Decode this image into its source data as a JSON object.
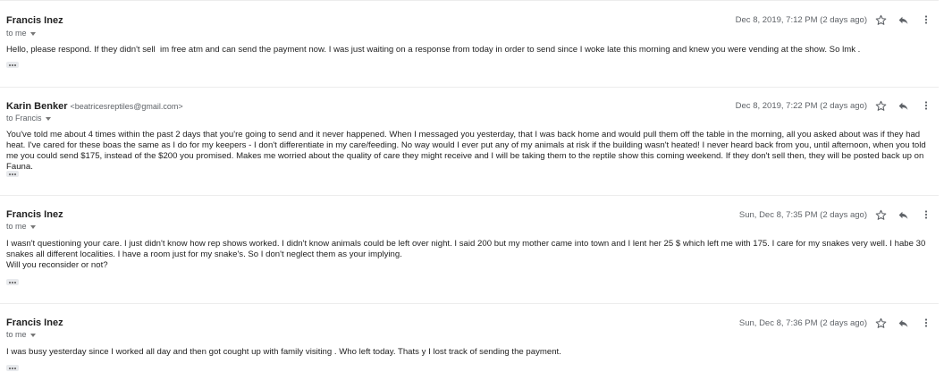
{
  "messages": [
    {
      "sender": "Francis Inez",
      "email": "",
      "to": "to me",
      "date": "Dec 8, 2019, 7:12 PM (2 days ago)",
      "body": "Hello, please respond. If they didn't sell  im free atm and can send the payment now. I was just waiting on a response from today in order to send since I woke late this morning and knew you were vending at the show. So lmk ."
    },
    {
      "sender": "Karin Benker",
      "email": "<beatricesreptiles@gmail.com>",
      "to": "to Francis",
      "date": "Dec 8, 2019, 7:22 PM (2 days ago)",
      "body": "You've told me about 4 times within the past 2 days that you're going to send and it never happened. When I messaged you yesterday, that I was back home and would pull them off the table in the morning, all you asked about was if they had heat. I've cared for these boas the same as I do for my keepers - I don't differentiate in my care/feeding. No way would I ever put any of my animals at risk if the building wasn't heated! I never heard back from you, until afternoon, when you told me you could send $175, instead of the $200 you promised. Makes me worried about the quality of care they might receive and I will be taking them to the reptile show this coming weekend. If they don't sell then, they will be posted back up on Fauna."
    },
    {
      "sender": "Francis Inez",
      "email": "",
      "to": "to me",
      "date": "Sun, Dec 8, 7:35 PM (2 days ago)",
      "body": "I wasn't questioning your care. I just didn't know how rep shows worked. I didn't know animals could be left over night. I said 200 but my mother came into town and I lent her 25 $ which left me with 175. I care for my snakes very well. I habe 30 snakes all different localities. I have a room just for my snake's. So I don't neglect them as your implying.\nWill you reconsider or not?"
    },
    {
      "sender": "Francis Inez",
      "email": "",
      "to": "to me",
      "date": "Sun, Dec 8, 7:36 PM (2 days ago)",
      "body": "I was busy yesterday since I worked all day and then got cought up with family visiting . Who left today. Thats y I lost track of sending the payment."
    }
  ],
  "icons": {
    "star": "star-icon",
    "reply": "reply-icon",
    "more": "more-vert-icon",
    "expand": "ellipsis-icon"
  },
  "colors": {
    "text": "#222222",
    "muted": "#5f6368",
    "divider": "#ececec"
  }
}
